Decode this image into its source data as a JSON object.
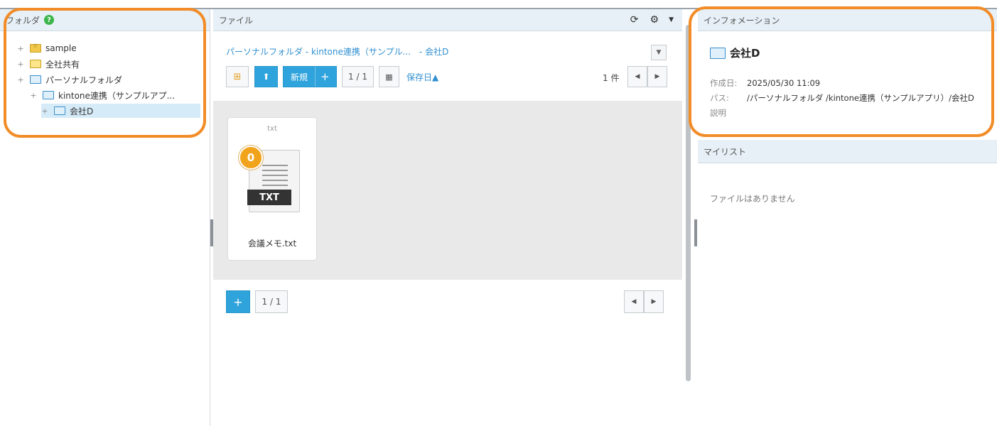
{
  "folder_panel": {
    "title": "フォルダ",
    "help_glyph": "?",
    "tree": [
      {
        "label": "sample",
        "depth": 0,
        "icon": "sample-folder-icon"
      },
      {
        "label": "全社共有",
        "depth": 0,
        "icon": "folder-icon"
      },
      {
        "label": "パーソナルフォルダ",
        "depth": 0,
        "icon": "folder-blue-icon"
      },
      {
        "label": "kintone連携（サンプルアプ...",
        "depth": 1,
        "icon": "folder-blue-icon"
      },
      {
        "label": "会社D",
        "depth": 2,
        "icon": "folder-blue-icon",
        "selected": true
      }
    ]
  },
  "file_panel": {
    "title": "ファイル",
    "breadcrumb": "パーソナルフォルダ - kintone連携（サンプル...　- 会社D",
    "toolbar": {
      "new_label": "新規",
      "plus": "+",
      "page": "1 / 1",
      "sort_label": "保存日▲",
      "count": "1 件"
    },
    "files": [
      {
        "ext": "txt",
        "type_label": "TXT",
        "badge": "0",
        "name": "会議メモ.txt"
      }
    ],
    "bottom": {
      "plus": "+",
      "page": "1 / 1"
    }
  },
  "info_panel": {
    "title": "インフォメーション",
    "folder_name": "会社D",
    "created_label": "作成日:",
    "created_value": "2025/05/30 11:09",
    "path_label": "パス:",
    "path_value": "/パーソナルフォルダ /kintone連携（サンプルアプリ）/会社D",
    "desc_label": "説明"
  },
  "mylist_panel": {
    "title": "マイリスト",
    "empty": "ファイルはありません"
  },
  "colors": {
    "highlight": "#f28c28",
    "accent": "#2fa3dc",
    "header_bg": "#e6f0f6"
  }
}
